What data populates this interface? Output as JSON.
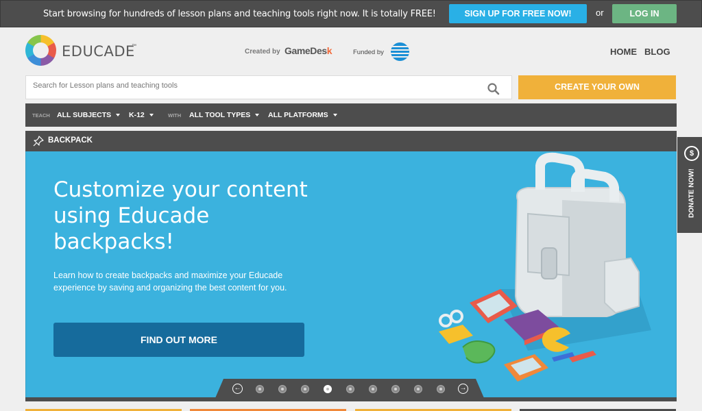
{
  "topbar": {
    "message": "Start browsing for hundreds of lesson plans and teaching tools right now. It is totally FREE!",
    "signup_label": "SIGN UP FOR FREE NOW!",
    "or_label": "or",
    "login_label": "LOG IN"
  },
  "header": {
    "logo_text": "EDUCADE",
    "logo_tm": "™",
    "created_by": "Created by",
    "gamedesk_main": "GameDes",
    "gamedesk_k": "k",
    "funded_by": "Funded by",
    "nav": {
      "home": "HOME",
      "blog": "BLOG"
    }
  },
  "search": {
    "placeholder": "Search for Lesson plans and teaching tools",
    "value": "",
    "create_label": "CREATE YOUR OWN"
  },
  "filters": {
    "teach_label": "TEACH",
    "with_label": "WITH",
    "subjects": "ALL SUBJECTS",
    "grades": "K-12",
    "tool_types": "ALL TOOL TYPES",
    "platforms": "ALL PLATFORMS"
  },
  "backpack": {
    "title": "BACKPACK",
    "heading": "Customize your content using Educade backpacks!",
    "body": "Learn how to create backpacks and maximize your Educade experience by saving and organizing the best content for you.",
    "cta": "FIND OUT MORE"
  },
  "pager": {
    "total": 9,
    "active": 4
  },
  "donate": {
    "label": "DONATE NOW!",
    "icon": "$"
  },
  "colors": {
    "dark_bar": "#4d4d4d",
    "signup_blue": "#29b0e6",
    "login_green": "#6cb583",
    "create_orange": "#f0b13a",
    "hero_blue": "#3bb2de",
    "cta_blue": "#166b9c"
  },
  "icons": {
    "search": "search-icon",
    "pin": "pin-icon",
    "prev": "arrow-left-icon",
    "next": "arrow-right-icon",
    "donate": "dollar-icon"
  }
}
